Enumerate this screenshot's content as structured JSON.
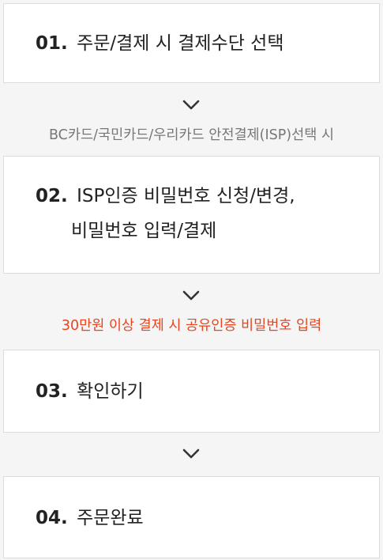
{
  "steps": [
    {
      "number": "01.",
      "text": "주문/결제 시 결제수단 선택"
    },
    {
      "number": "02.",
      "text": "ISP인증 비밀번호 신청/변경,",
      "text2": "비밀번호 입력/결제"
    },
    {
      "number": "03.",
      "text": "확인하기"
    },
    {
      "number": "04.",
      "text": "주문완료"
    }
  ],
  "notes": {
    "bc_isp": "BC카드/국민카드/우리카드 안전결제(ISP)선택 시",
    "over_300k": "30만원 이상 결제 시 공유인증 비밀번호 입력"
  },
  "icons": [
    "chevron-down-icon"
  ],
  "colors": {
    "accent_red": "#e8441d",
    "note_gray": "#777777",
    "box_border": "#dcdcdc",
    "background": "#f5f5f5"
  }
}
